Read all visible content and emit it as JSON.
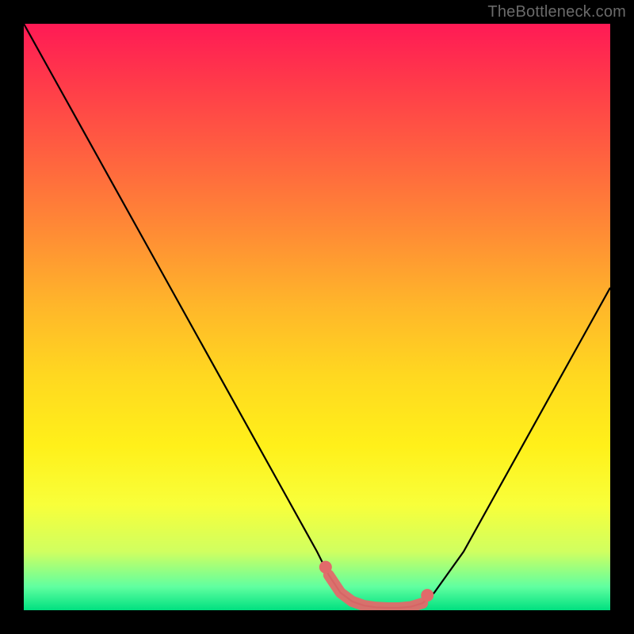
{
  "watermark": "TheBottleneck.com",
  "chart_data": {
    "type": "line",
    "title": "",
    "xlabel": "",
    "ylabel": "",
    "xlim": [
      0,
      100
    ],
    "ylim": [
      0,
      100
    ],
    "x": [
      0,
      5,
      10,
      15,
      20,
      25,
      30,
      35,
      40,
      45,
      50,
      52,
      54,
      56,
      58,
      60,
      62,
      64,
      66,
      68,
      70,
      75,
      80,
      85,
      90,
      95,
      100
    ],
    "values": [
      100,
      91,
      82,
      73,
      64,
      55,
      46,
      37,
      28,
      19,
      10,
      6,
      3,
      1.5,
      0.8,
      0.5,
      0.4,
      0.4,
      0.6,
      1.2,
      3,
      10,
      19,
      28,
      37,
      46,
      55
    ],
    "annotations": [
      {
        "type": "highlight",
        "x_range": [
          52,
          68
        ],
        "color": "#e26a6a"
      }
    ]
  }
}
